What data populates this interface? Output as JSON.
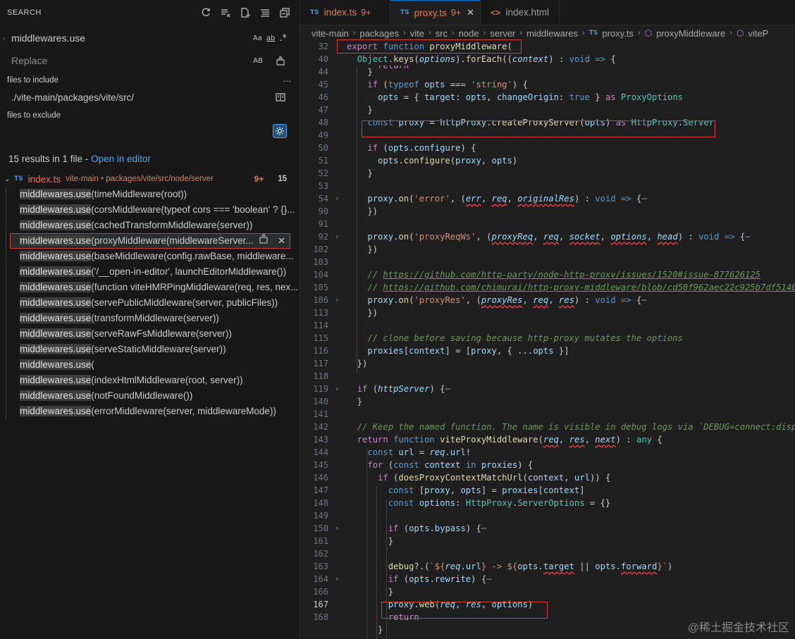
{
  "search": {
    "title": "SEARCH",
    "query": "middlewares.use",
    "replace_placeholder": "Replace",
    "opt_case": "Aa",
    "opt_word": "ab",
    "opt_regex": ".*",
    "opt_preserve": "AB",
    "include_label": "files to include",
    "include_value": "./vite-main/packages/vite/src/",
    "exclude_label": "files to exclude",
    "summary_prefix": "15 results in 1 file - ",
    "summary_link": "Open in editor",
    "file": {
      "name": "index.ts",
      "path": "vite-main • packages/vite/src/node/server",
      "problems": "9+",
      "count": "15"
    },
    "results": [
      "timeMiddleware(root))",
      "corsMiddleware(typeof cors === 'boolean' ? {}...",
      "cachedTransformMiddleware(server))",
      "proxyMiddleware(middlewareServer...",
      "baseMiddleware(config.rawBase, middleware...",
      "'/__open-in-editor', launchEditorMiddleware())",
      "function viteHMRPingMiddleware(req, res, nex...",
      "servePublicMiddleware(server, publicFiles))",
      "transformMiddleware(server))",
      "serveRawFsMiddleware(server))",
      "serveStaticMiddleware(server))",
      "",
      "indexHtmlMiddleware(root, server))",
      "notFoundMiddleware())",
      "errorMiddleware(server, middlewareMode))"
    ]
  },
  "tabs": [
    {
      "label": "index.ts",
      "badge": "TS",
      "count": "9+"
    },
    {
      "label": "proxy.ts",
      "badge": "TS",
      "count": "9+"
    },
    {
      "label": "index.html",
      "badge": "<>"
    }
  ],
  "breadcrumb": [
    "vite-main",
    "packages",
    "vite",
    "src",
    "node",
    "server",
    "middlewares",
    "proxy.ts",
    "proxyMiddleware",
    "viteP"
  ],
  "line_numbers": [
    "32",
    "40",
    "44",
    "45",
    "46",
    "47",
    "48",
    "49",
    "50",
    "51",
    "52",
    "53",
    "54",
    "90",
    "91",
    "92",
    "102",
    "103",
    "104",
    "105",
    "106",
    "113",
    "114",
    "115",
    "116",
    "117",
    "118",
    "119",
    "140",
    "141",
    "142",
    "143",
    "144",
    "145",
    "146",
    "147",
    "148",
    "149",
    "150",
    "161",
    "162",
    "163",
    "164",
    "166",
    "167",
    "168",
    ""
  ],
  "watermark": "@稀土掘金技术社区"
}
